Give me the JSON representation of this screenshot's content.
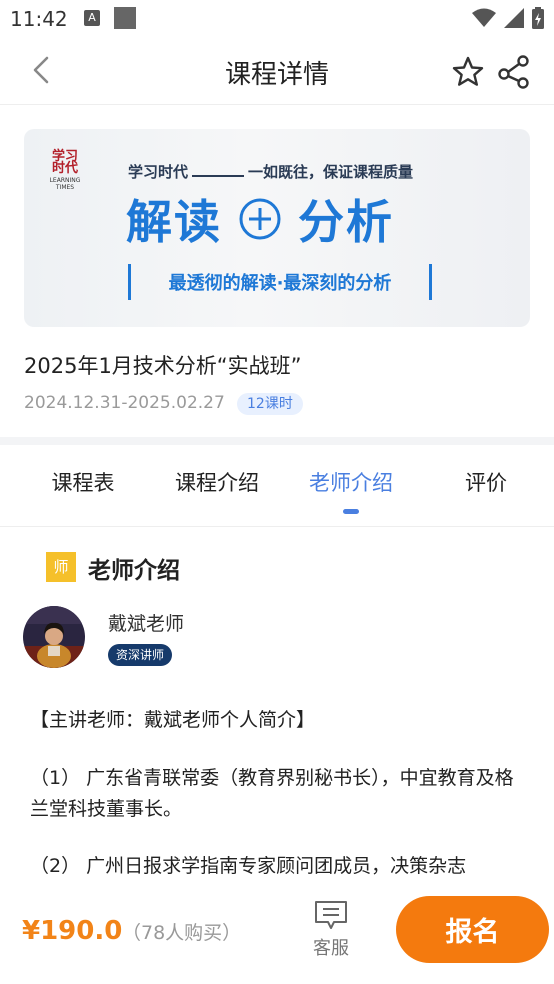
{
  "status_bar": {
    "time": "11:42",
    "notification_letter": "A"
  },
  "header": {
    "title": "课程详情"
  },
  "banner": {
    "logo_lines": [
      "学习",
      "时代"
    ],
    "logo_en": [
      "LEARNING",
      "TIMES"
    ],
    "subtitle_left": "学习时代",
    "subtitle_right": "一如既往，保证课程质量",
    "headline_left": "解读",
    "headline_right": "分析",
    "tagline": "最透彻的解读·最深刻的分析",
    "colors": {
      "accent": "#1e78d6",
      "logo_red": "#b3202a"
    }
  },
  "course": {
    "title": "2025年1月技术分析“实战班”",
    "dates": "2024.12.31-2025.02.27",
    "lessons_badge": "12课时"
  },
  "tabs": [
    {
      "label": "课程表",
      "active": false
    },
    {
      "label": "课程介绍",
      "active": false
    },
    {
      "label": "老师介绍",
      "active": true
    },
    {
      "label": "评价",
      "active": false
    }
  ],
  "teacher_section": {
    "icon_char": "师",
    "title": "老师介绍",
    "teacher_name": "戴斌老师",
    "teacher_badge": "资深讲师",
    "bio": [
      "【主讲老师：戴斌老师个人简介】",
      "（1）  广东省青联常委（教育界别秘书长），中宜教育及格兰堂科技董事长。",
      "（2）  广州日报求学指南专家顾问团成员，决策杂志"
    ]
  },
  "bottom_bar": {
    "price": "¥190.0",
    "buyers": "（78人购买）",
    "customer_service": "客服",
    "signup_button": "报名",
    "colors": {
      "price": "#f28418",
      "signup": "#f47a0e"
    }
  },
  "colors": {
    "tab_active": "#4a7fe0",
    "section_icon": "#f5c02a",
    "teacher_badge": "#163a6b"
  }
}
